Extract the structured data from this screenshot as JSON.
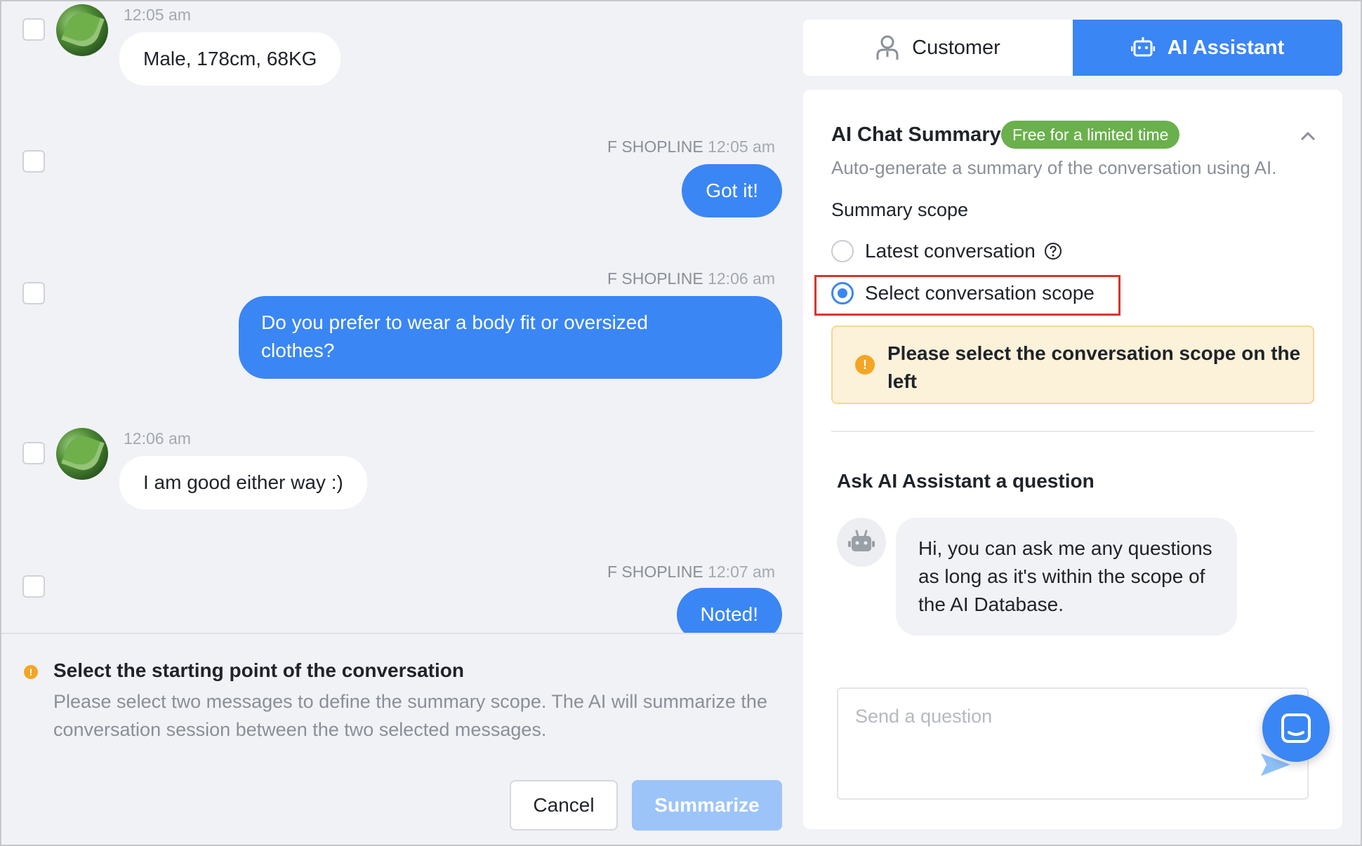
{
  "messages": [
    {
      "direction": "in",
      "time": "12:05 am",
      "text": "Male, 178cm, 68KG"
    },
    {
      "direction": "out",
      "sender": "F SHOPLINE",
      "time": "12:05 am",
      "text": "Got it!"
    },
    {
      "direction": "out",
      "sender": "F SHOPLINE",
      "time": "12:06 am",
      "line1": "Do you prefer to wear a body fit or oversized",
      "line2": "clothes?"
    },
    {
      "direction": "in",
      "time": "12:06 am",
      "text": "I am good either way :)"
    },
    {
      "direction": "out",
      "sender": "F SHOPLINE",
      "time": "12:07 am",
      "text": "Noted!"
    }
  ],
  "selection_hint": {
    "title": "Select the starting point of the conversation",
    "body": "Please select two messages to define the summary scope. The AI will summarize the conversation session between the two selected messages."
  },
  "actions": {
    "cancel_label": "Cancel",
    "summarize_label": "Summarize"
  },
  "tabs": [
    {
      "label": "Customer",
      "icon": "user-icon",
      "active": false
    },
    {
      "label": "AI Assistant",
      "icon": "robot-icon",
      "active": true
    }
  ],
  "summary": {
    "title": "AI Chat Summary",
    "badge": "Free for a limited time",
    "description": "Auto-generate a summary of the conversation using AI.",
    "scope_label": "Summary scope",
    "options": [
      {
        "label": "Latest conversation",
        "selected": false
      },
      {
        "label": "Select conversation scope",
        "selected": true
      }
    ],
    "notice": "Please select the conversation scope on the left"
  },
  "ask": {
    "title": "Ask AI Assistant a question",
    "bot_message": "Hi, you can ask me any questions as long as it's within the scope of the AI Database.",
    "input_placeholder": "Send a question"
  },
  "colors": {
    "primary": "#3a86f5",
    "badge_green": "#6ab04c",
    "warning": "#f5a524",
    "highlight_red": "#d9352b"
  }
}
